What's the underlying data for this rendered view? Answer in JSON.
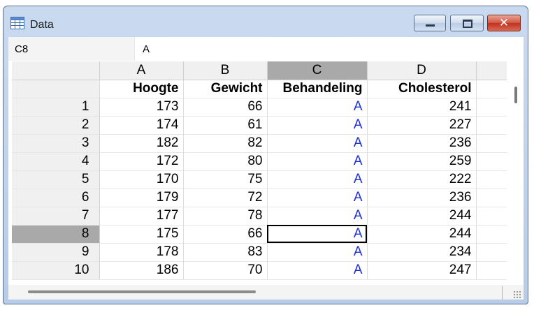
{
  "window": {
    "title": "Data",
    "app_icon": "spreadsheet-icon",
    "controls": [
      "minimize-icon",
      "maximize-icon",
      "close-icon"
    ]
  },
  "formula_bar": {
    "name_box": "C8",
    "value": "A"
  },
  "sheet": {
    "active_cell": "C8",
    "column_letters": [
      "A",
      "B",
      "C",
      "D"
    ],
    "column_names": [
      "Hoogte",
      "Gewicht",
      "Behandeling",
      "Cholesterol"
    ],
    "rows": [
      {
        "n": "1",
        "hoogte": "173",
        "gewicht": "66",
        "behandeling": "A",
        "cholesterol": "241"
      },
      {
        "n": "2",
        "hoogte": "174",
        "gewicht": "61",
        "behandeling": "A",
        "cholesterol": "227"
      },
      {
        "n": "3",
        "hoogte": "182",
        "gewicht": "82",
        "behandeling": "A",
        "cholesterol": "236"
      },
      {
        "n": "4",
        "hoogte": "172",
        "gewicht": "80",
        "behandeling": "A",
        "cholesterol": "259"
      },
      {
        "n": "5",
        "hoogte": "170",
        "gewicht": "75",
        "behandeling": "A",
        "cholesterol": "222"
      },
      {
        "n": "6",
        "hoogte": "179",
        "gewicht": "72",
        "behandeling": "A",
        "cholesterol": "236"
      },
      {
        "n": "7",
        "hoogte": "177",
        "gewicht": "78",
        "behandeling": "A",
        "cholesterol": "244"
      },
      {
        "n": "8",
        "hoogte": "175",
        "gewicht": "66",
        "behandeling": "A",
        "cholesterol": "244"
      },
      {
        "n": "9",
        "hoogte": "178",
        "gewicht": "83",
        "behandeling": "A",
        "cholesterol": "234"
      },
      {
        "n": "10",
        "hoogte": "186",
        "gewicht": "70",
        "behandeling": "A",
        "cholesterol": "247"
      }
    ]
  },
  "colors": {
    "text_values": "#1c2fd6",
    "active_header": "#a9a9a9",
    "header_bg": "#f0f0f0"
  }
}
